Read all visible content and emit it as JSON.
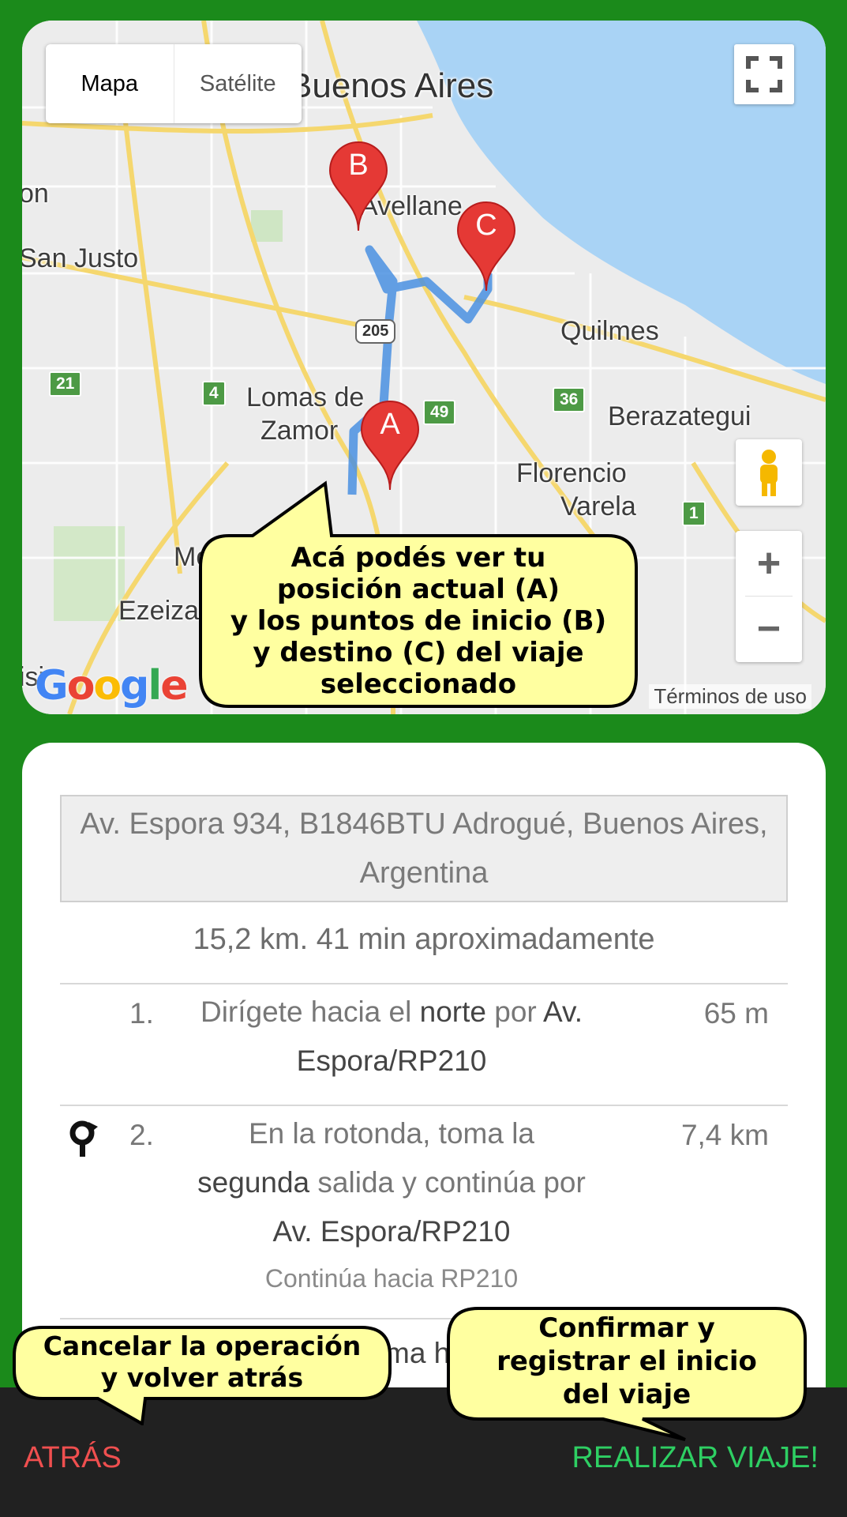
{
  "map": {
    "type_controls": [
      "Mapa",
      "Satélite"
    ],
    "place_labels": {
      "buenos_aires": "Buenos Aires",
      "avellaneda": "Avellane",
      "san_justo": "San Justo",
      "on": "on",
      "quilmes": "Quilmes",
      "lomas_1": "Lomas de",
      "lomas_2": "Zamor",
      "berazategui": "Berazategui",
      "florencio_1": "Florencio",
      "florencio_2": "Varela",
      "mo": "Mo",
      "ezeiza": "Ezeiza",
      "isi": "isi"
    },
    "road_shields": {
      "r21": "21",
      "r4": "4",
      "r205": "205",
      "r49": "49",
      "r36": "36",
      "r1": "1"
    },
    "markers": {
      "a": "A",
      "b": "B",
      "c": "C"
    },
    "zoom_in": "+",
    "zoom_out": "−",
    "google_logo": "Google",
    "terms": "Términos de uso",
    "icons": [
      "fullscreen-icon",
      "pegman-icon",
      "map-marker-icon"
    ]
  },
  "directions": {
    "destination_address": "Av. Espora 934, B1846BTU Adrogué, Buenos Aires, Argentina",
    "summary": "15,2 km. 41 min aproximadamente",
    "steps": [
      {
        "num": "1.",
        "text_1": "Dirígete hacia el ",
        "bold_1": "norte",
        "text_2": " por ",
        "bold_2": "Av. Espora/RP210",
        "distance": "65 m"
      },
      {
        "num": "2.",
        "text_1": "En la rotonda, toma la ",
        "bold_1": "segunda",
        "text_2": " salida y continúa por ",
        "bold_2": "Av. Espora/RP210",
        "note": "Continúa hacia RP210",
        "distance": "7,4 km",
        "icon": "roundabout-icon"
      }
    ],
    "partial_step_text": "ma h"
  },
  "bottom_bar": {
    "back_label": "ATRÁS",
    "go_label": "REALIZAR VIAJE!",
    "back_color": "#ef4f4f",
    "go_color": "#2ecf63"
  },
  "callouts": {
    "map_hint": [
      "Acá podés ver tu",
      "posición actual (A)",
      "y los puntos de inicio (B)",
      "y destino (C) del viaje",
      "seleccionado"
    ],
    "back_hint": [
      "Cancelar la operación",
      "y volver atrás"
    ],
    "confirm_hint": [
      "Confirmar y",
      "registrar el inicio",
      "del viaje"
    ]
  },
  "colors": {
    "background": "#1b8a1b",
    "marker": "#e53935",
    "route": "#4a90e2",
    "water": "#a9d3f5",
    "callout": "#ffffa0"
  }
}
